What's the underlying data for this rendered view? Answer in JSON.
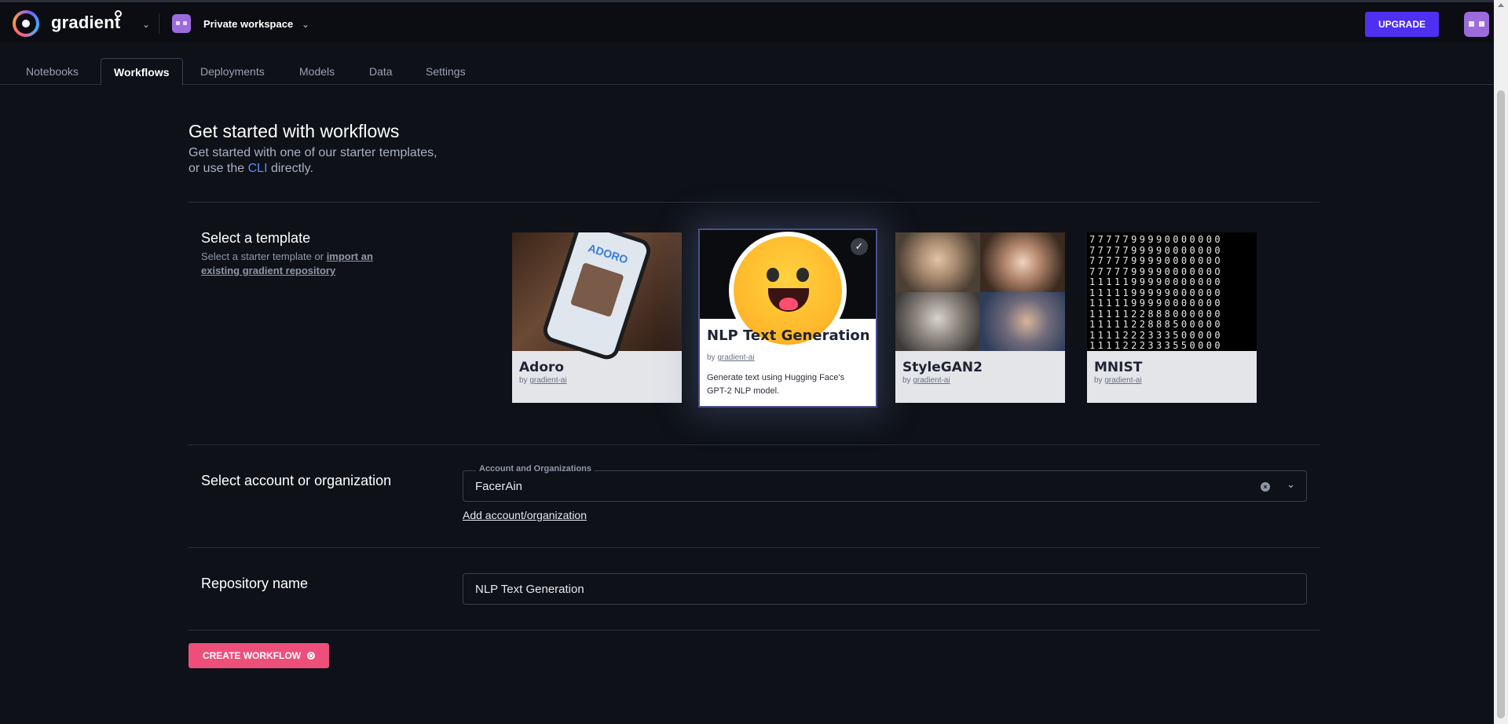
{
  "header": {
    "brand": "gradient",
    "workspace_name": "Private workspace",
    "upgrade_label": "UPGRADE"
  },
  "tabs": [
    {
      "label": "Notebooks",
      "active": false
    },
    {
      "label": "Workflows",
      "active": true
    },
    {
      "label": "Deployments",
      "active": false
    },
    {
      "label": "Models",
      "active": false
    },
    {
      "label": "Data",
      "active": false
    },
    {
      "label": "Settings",
      "active": false
    }
  ],
  "intro": {
    "title": "Get started with workflows",
    "subtitle_line1": "Get started with one of our starter templates,",
    "subtitle_line2_pre": "or use the ",
    "cli_link": "CLI",
    "subtitle_line2_post": " directly."
  },
  "templates_section": {
    "label": "Select a template",
    "sub_text": "Select a starter template or ",
    "sub_link": "import an existing gradient repository",
    "cards": [
      {
        "name": "Adoro",
        "by_prefix": "by ",
        "author": "gradient-ai",
        "image_caption": "ADORO",
        "selected": false
      },
      {
        "name": "NLP Text Generation",
        "by_prefix": "by ",
        "author": "gradient-ai",
        "description": "Generate text using Hugging Face's GPT-2 NLP model.",
        "selected": true
      },
      {
        "name": "StyleGAN2",
        "by_prefix": "by ",
        "author": "gradient-ai",
        "selected": false
      },
      {
        "name": "MNIST",
        "by_prefix": "by ",
        "author": "gradient-ai",
        "selected": false
      }
    ]
  },
  "account_section": {
    "label": "Select account or organization",
    "field_legend": "Account and Organizations",
    "field_value": "FacerAin",
    "add_link": "Add account/organization"
  },
  "repo_section": {
    "label": "Repository name",
    "field_value": "NLP Text Generation"
  },
  "create_button": "CREATE WORKFLOW",
  "colors": {
    "background": "#0e1117",
    "upgrade": "#4f2ff0",
    "create": "#ed4f7a",
    "link": "#5b8cff"
  },
  "icons": {
    "logo": "gradient-logo-icon",
    "workspace_avatar": "workspace-avatar-icon",
    "check": "check-icon",
    "clear": "clear-icon",
    "dropdown": "chevron-down-icon",
    "create": "plus-circle-icon"
  }
}
